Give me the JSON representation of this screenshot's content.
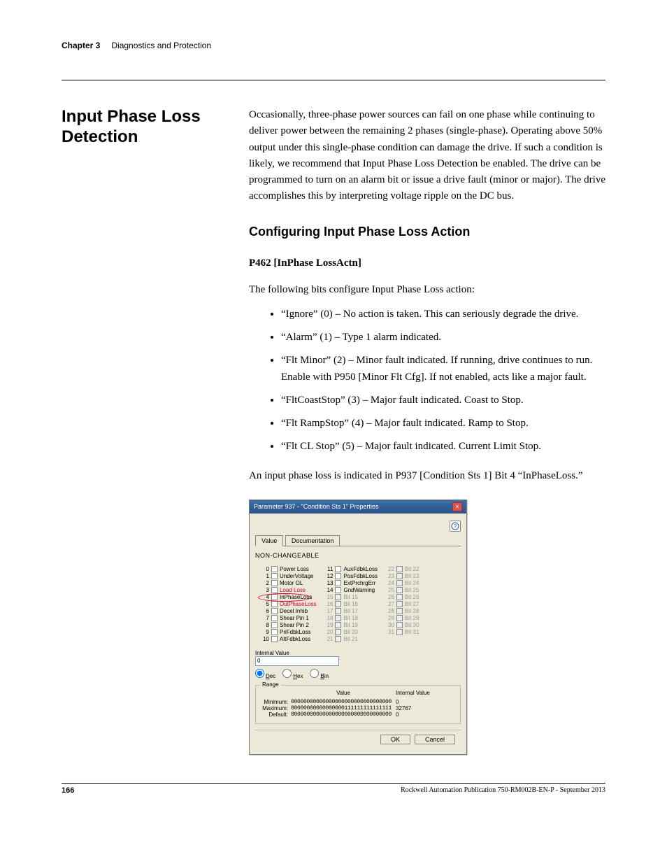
{
  "header": {
    "chapter": "Chapter 3",
    "title": "Diagnostics and Protection"
  },
  "section": {
    "title": "Input Phase Loss Detection",
    "intro": "Occasionally, three-phase power sources can fail on one phase while continuing to deliver power between the remaining 2 phases (single-phase). Operating above 50% output under this single-phase condition can damage the drive. If such a condition is likely, we recommend that Input Phase Loss Detection be enabled. The drive can be programmed to turn on an alarm bit or issue a drive fault (minor or major). The drive accomplishes this by interpreting voltage ripple on the DC bus."
  },
  "subsection": {
    "title": "Configuring Input Phase Loss Action",
    "param": "P462 [InPhase LossActn]",
    "lead": "The following bits configure Input Phase Loss action:",
    "bits": [
      "“Ignore” (0) – No action is taken. This can seriously degrade the drive.",
      "“Alarm” (1) – Type 1 alarm indicated.",
      "“Flt Minor” (2) – Minor fault indicated. If running, drive continues to run. Enable with P950 [Minor Flt Cfg]. If not enabled, acts like a major fault.",
      "“FltCoastStop” (3) – Major fault indicated. Coast to Stop.",
      "“Flt RampStop” (4) – Major fault indicated. Ramp to Stop.",
      "“Flt CL Stop” (5) – Major fault indicated. Current Limit Stop."
    ],
    "note": "An input phase loss is indicated in P937 [Condition Sts 1] Bit 4 “InPhaseLoss.”"
  },
  "dialog": {
    "title": "Parameter 937 - \"Condition Sts 1\" Properties",
    "help_icon": "?",
    "close_icon": "×",
    "tab_value": "Value",
    "tab_doc": "Documentation",
    "nonchg": "NON-CHANGEABLE",
    "bits_col1": [
      {
        "n": "0",
        "t": "Power Loss",
        "d": false
      },
      {
        "n": "1",
        "t": "UnderVoltage",
        "d": false
      },
      {
        "n": "2",
        "t": "Motor OL",
        "d": false
      },
      {
        "n": "3",
        "t": "Load Loss",
        "d": false,
        "strike": true
      },
      {
        "n": "4",
        "t": "InPhaseLoss",
        "d": false,
        "circled": true
      },
      {
        "n": "5",
        "t": "OutPhaseLoss",
        "d": false,
        "strike": true
      },
      {
        "n": "6",
        "t": "Decel Inhib",
        "d": false
      },
      {
        "n": "7",
        "t": "Shear Pin 1",
        "d": false
      },
      {
        "n": "8",
        "t": "Shear Pin 2",
        "d": false
      },
      {
        "n": "9",
        "t": "PriFdbkLoss",
        "d": false
      },
      {
        "n": "10",
        "t": "AltFdbkLoss",
        "d": false
      }
    ],
    "bits_col2": [
      {
        "n": "11",
        "t": "AuxFdbkLoss",
        "d": false
      },
      {
        "n": "12",
        "t": "PosFdbkLoss",
        "d": false
      },
      {
        "n": "13",
        "t": "ExtPrchrgErr",
        "d": false
      },
      {
        "n": "14",
        "t": "GndWarning",
        "d": false
      },
      {
        "n": "15",
        "t": "Bit 15",
        "d": true
      },
      {
        "n": "16",
        "t": "Bit 16",
        "d": true
      },
      {
        "n": "17",
        "t": "Bit 17",
        "d": true
      },
      {
        "n": "18",
        "t": "Bit 18",
        "d": true
      },
      {
        "n": "19",
        "t": "Bit 19",
        "d": true
      },
      {
        "n": "20",
        "t": "Bit 20",
        "d": true
      },
      {
        "n": "21",
        "t": "Bit 21",
        "d": true
      }
    ],
    "bits_col3": [
      {
        "n": "22",
        "t": "Bit 22",
        "d": true
      },
      {
        "n": "23",
        "t": "Bit 23",
        "d": true
      },
      {
        "n": "24",
        "t": "Bit 24",
        "d": true
      },
      {
        "n": "25",
        "t": "Bit 25",
        "d": true
      },
      {
        "n": "26",
        "t": "Bit 26",
        "d": true
      },
      {
        "n": "27",
        "t": "Bit 27",
        "d": true
      },
      {
        "n": "28",
        "t": "Bit 28",
        "d": true
      },
      {
        "n": "29",
        "t": "Bit 29",
        "d": true
      },
      {
        "n": "30",
        "t": "Bit 30",
        "d": true
      },
      {
        "n": "31",
        "t": "Bit 31",
        "d": true
      }
    ],
    "internal_label": "Internal Value",
    "internal_value": "0",
    "radio_dec": "Dec",
    "radio_hex": "Hex",
    "radio_bin": "Bin",
    "range_label": "Range",
    "range_value_hdr": "Value",
    "range_iv_hdr": "Internal Value",
    "range_rows": [
      {
        "lbl": "Minimum:",
        "val": "00000000000000000000000000000000",
        "iv": "0"
      },
      {
        "lbl": "Maximum:",
        "val": "00000000000000000111111111111111",
        "iv": "32767"
      },
      {
        "lbl": "Default:",
        "val": "00000000000000000000000000000000",
        "iv": "0"
      }
    ],
    "btn_ok": "OK",
    "btn_cancel": "Cancel"
  },
  "footer": {
    "page": "166",
    "pub": "Rockwell Automation Publication 750-RM002B-EN-P - September 2013"
  }
}
